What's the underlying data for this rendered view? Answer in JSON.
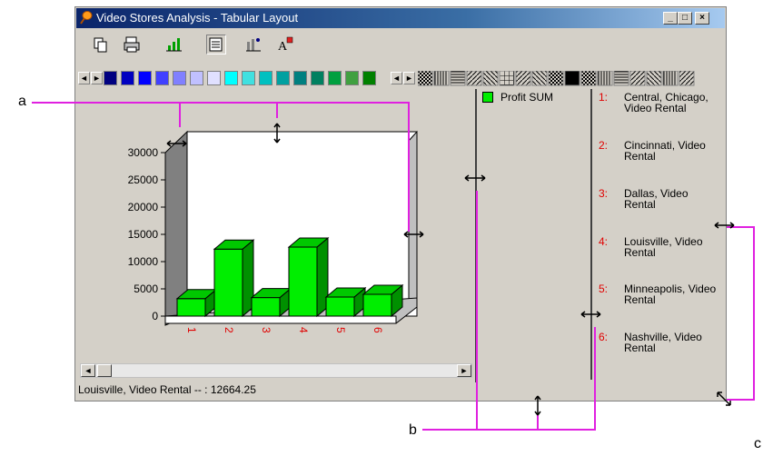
{
  "window": {
    "title": "Video Stores Analysis - Tabular Layout",
    "buttons": {
      "minimize": "_",
      "maximize": "□",
      "close": "×"
    }
  },
  "toolbar": {
    "icons": [
      "copy-icon",
      "print-icon",
      "bar-chart-icon",
      "list-view-icon",
      "chart-options-icon",
      "font-icon"
    ]
  },
  "palette": {
    "colors": [
      "#000080",
      "#0000c0",
      "#0000ff",
      "#4040ff",
      "#8080ff",
      "#c0c0ff",
      "#e0e0ff",
      "#00ffff",
      "#40e0e0",
      "#00c0c0",
      "#00a0a0",
      "#008080",
      "#008060",
      "#00a040",
      "#40a040",
      "#008000"
    ]
  },
  "chart": {
    "y_ticks": [
      "30000",
      "25000",
      "20000",
      "15000",
      "10000",
      "5000",
      "0"
    ],
    "x_ticks": [
      "1",
      "2",
      "3",
      "4",
      "5",
      "6"
    ],
    "bar_color": "#00ee00"
  },
  "chart_data": {
    "type": "bar",
    "categories": [
      "1",
      "2",
      "3",
      "4",
      "5",
      "6"
    ],
    "series": [
      {
        "name": "Profit SUM",
        "values": [
          3200,
          12300,
          3400,
          12664.25,
          3500,
          4000
        ]
      }
    ],
    "ylim": [
      0,
      30000
    ]
  },
  "legend": {
    "series_label": "Profit SUM",
    "entries": [
      {
        "num": "1:",
        "text": "Central, Chicago, Video Rental"
      },
      {
        "num": "2:",
        "text": "Cincinnati, Video Rental"
      },
      {
        "num": "3:",
        "text": "Dallas, Video Rental"
      },
      {
        "num": "4:",
        "text": "Louisville, Video Rental"
      },
      {
        "num": "5:",
        "text": "Minneapolis, Video Rental"
      },
      {
        "num": "6:",
        "text": "Nashville, Video Rental"
      }
    ]
  },
  "status": {
    "text": "Louisville, Video Rental -- : 12664.25"
  },
  "callouts": {
    "a": "a",
    "b": "b",
    "c": "c"
  },
  "colors": {
    "annotation": "#e020e0",
    "legend_number": "#e00000"
  }
}
